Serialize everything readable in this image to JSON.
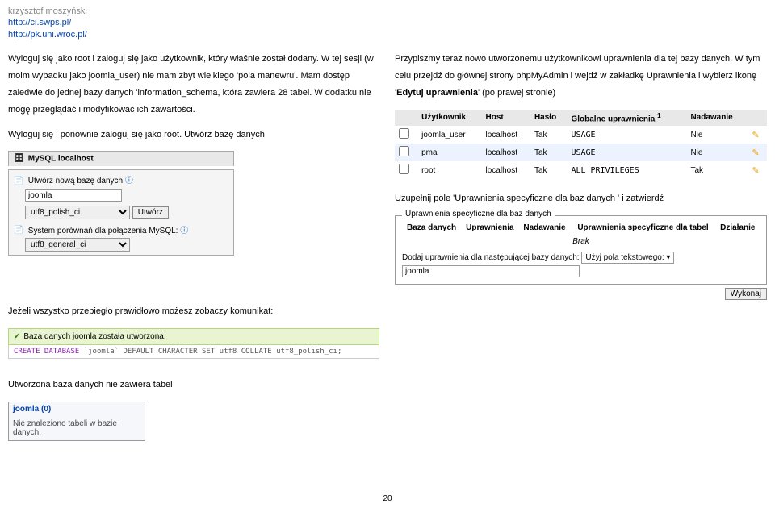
{
  "header": {
    "author": "krzysztof moszyński",
    "link1": "http://ci.swps.pl/",
    "link2": "http://pk.uni.wroc.pl/"
  },
  "left": {
    "p1": "Wyloguj się jako root i zaloguj się jako użytkownik, który właśnie został dodany. W tej sesji (w moim wypadku jako joomla_user) nie mam zbyt wielkiego 'pola manewru'. Mam dostęp zaledwie do jednej bazy danych 'information_schema, która zawiera 28 tabel. W dodatku nie mogę przeglądać i modyfikować ich zawartości.",
    "p2": "Wyloguj się i ponownie zaloguj się jako root. Utwórz bazę danych",
    "mysql_title": "MySQL localhost",
    "create_label": "Utwórz nową bazę danych",
    "db_name": "joomla",
    "collation1": "utf8_polish_ci",
    "create_btn": "Utwórz",
    "syscmp_label": "System porównań dla połączenia MySQL:",
    "collation2": "utf8_general_ci"
  },
  "right": {
    "p1a": "Przypiszmy teraz nowo utworzonemu użytkownikowi uprawnienia dla tej bazy danych. W tym celu przejdź do głównej strony phpMyAdmin i wejdź w zakładkę Uprawnienia i wybierz ikonę '",
    "p1b": "Edytuj uprawnienia",
    "p1c": "' (po prawej stronie)",
    "tbl": {
      "h1": "Użytkownik",
      "h2": "Host",
      "h3": "Hasło",
      "h4": "Globalne uprawnienia",
      "h5": "Nadawanie",
      "rows": [
        {
          "u": "joomla_user",
          "h": "localhost",
          "p": "Tak",
          "g": "USAGE",
          "n": "Nie"
        },
        {
          "u": "pma",
          "h": "localhost",
          "p": "Tak",
          "g": "USAGE",
          "n": "Nie"
        },
        {
          "u": "root",
          "h": "localhost",
          "p": "Tak",
          "g": "ALL PRIVILEGES",
          "n": "Tak"
        }
      ]
    },
    "p2": "Uzupełnij pole 'Uprawnienia specyficzne dla baz danych ' i zatwierdź",
    "fs": {
      "legend": "Uprawnienia specyficzne dla baz danych",
      "h1": "Baza danych",
      "h2": "Uprawnienia",
      "h3": "Nadawanie",
      "h4": "Uprawnienia specyficzne dla tabel",
      "h5": "Działanie",
      "brak": "Brak",
      "add_label": "Dodaj uprawnienia dla następującej bazy danych:",
      "select_opt": "Użyj pola tekstowego: ▾",
      "db_name": "joomla",
      "go": "Wykonaj"
    }
  },
  "below": {
    "p_success": "Jeżeli wszystko przebiegło prawidłowo możesz zobaczy komunikat:",
    "msg": "Baza danych joomla została utworzona.",
    "sql_raw": "CREATE DATABASE `joomla` DEFAULT CHARACTER SET utf8 COLLATE utf8_polish_ci;",
    "sql_kw": "CREATE DATABASE",
    "sql_rest": " `joomla` DEFAULT CHARACTER SET utf8 COLLATE utf8_polish_ci;",
    "p_notables": "Utworzona baza danych nie zawiera tabel",
    "sb_head": "joomla (0)",
    "sb_body": "Nie znaleziono tabeli w bazie danych."
  },
  "pagenum": "20"
}
